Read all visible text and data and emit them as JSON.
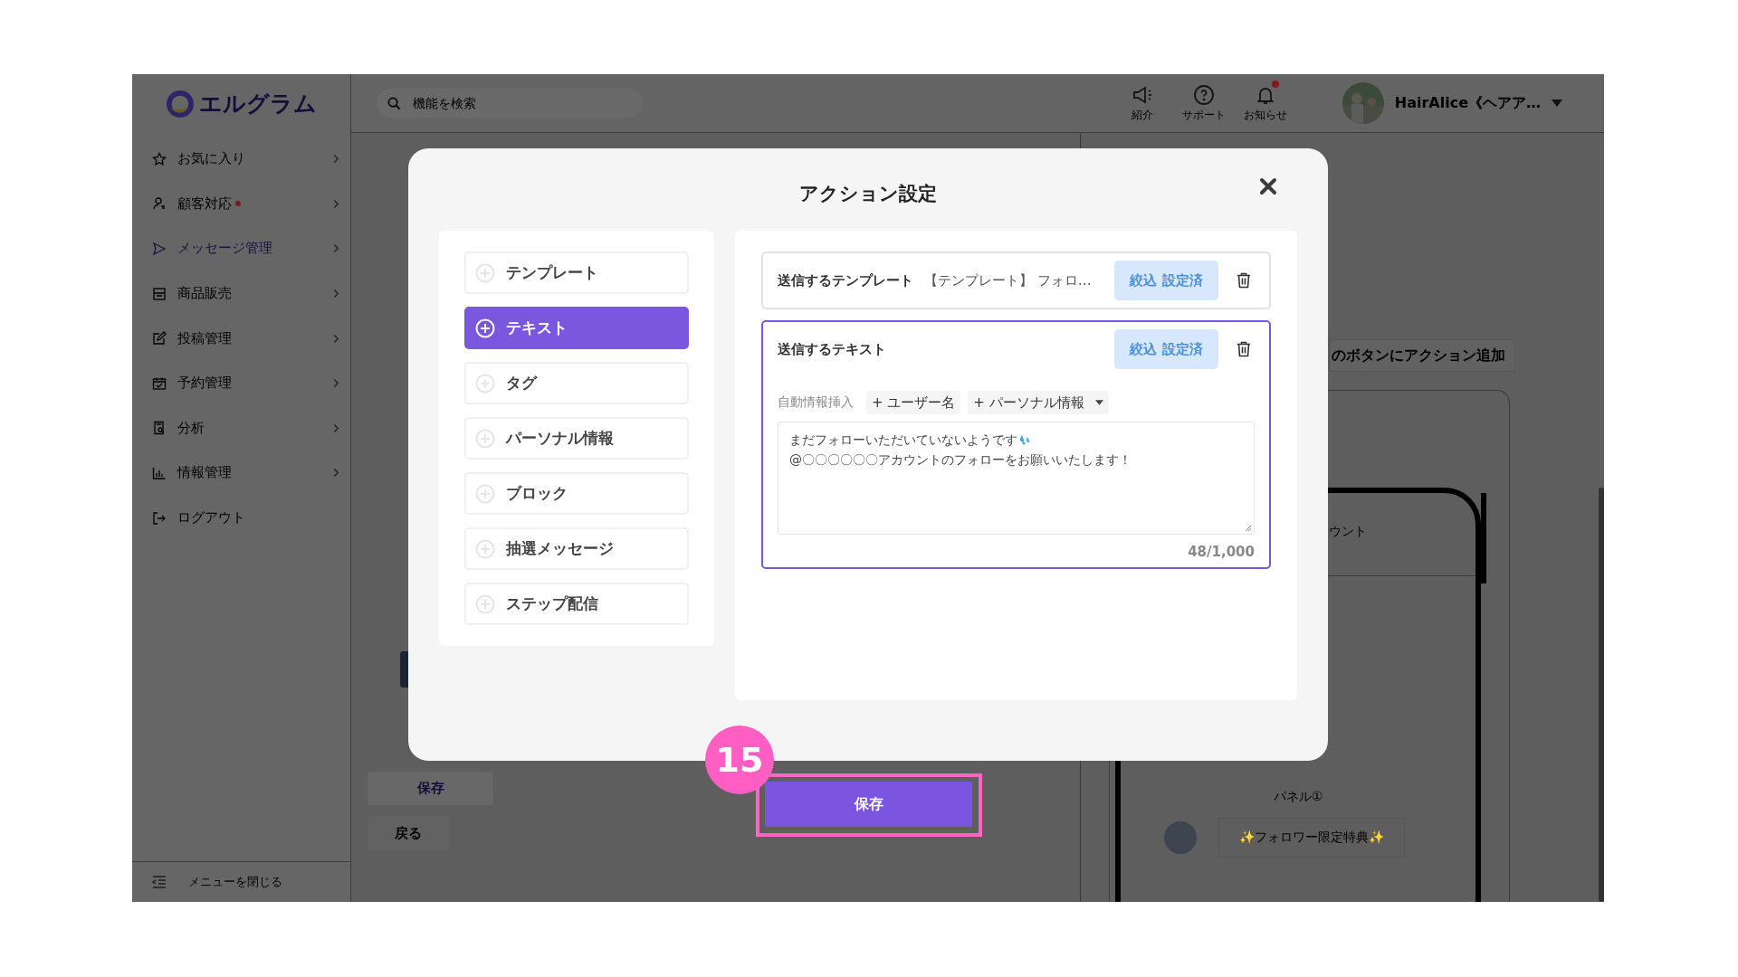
{
  "header": {
    "logo": "エルグラム",
    "search": {
      "placeholder": "機能を検索"
    },
    "icons": [
      {
        "kind": "megaphone",
        "label": "紹介",
        "badge": false
      },
      {
        "kind": "help",
        "label": "サポート",
        "badge": false
      },
      {
        "kind": "bell",
        "label": "お知らせ",
        "badge": true
      }
    ],
    "account": {
      "name": "HairAlice《ヘアア…"
    }
  },
  "sidebar": {
    "items": [
      {
        "label": "お気に入り",
        "selected": false,
        "badge": false,
        "chevron": true
      },
      {
        "label": "顧客対応",
        "selected": false,
        "badge": true,
        "chevron": true
      },
      {
        "label": "メッセージ管理",
        "selected": true,
        "badge": false,
        "chevron": true
      },
      {
        "label": "商品販売",
        "selected": false,
        "badge": false,
        "chevron": true
      },
      {
        "label": "投稿管理",
        "selected": false,
        "badge": false,
        "chevron": true
      },
      {
        "label": "予約管理",
        "selected": false,
        "badge": false,
        "chevron": true
      },
      {
        "label": "分析",
        "selected": false,
        "badge": false,
        "chevron": true
      },
      {
        "label": "情報管理",
        "selected": false,
        "badge": false,
        "chevron": true
      },
      {
        "label": "ログアウト",
        "selected": false,
        "badge": false,
        "chevron": false
      }
    ],
    "collapse_label": "メニューを閉じる"
  },
  "page": {
    "save_button": "保存",
    "back_button": "戻る",
    "add_action_button": "のボタンにアクション追加",
    "preview": {
      "account_text": "ウント",
      "panel_label": "パネル①",
      "panel_button": "✨フォロワー限定特典✨"
    }
  },
  "modal": {
    "title": "アクション設定",
    "action_types": [
      {
        "label": "テンプレート",
        "selected": false
      },
      {
        "label": "テキスト",
        "selected": true
      },
      {
        "label": "タグ",
        "selected": false
      },
      {
        "label": "パーソナル情報",
        "selected": false
      },
      {
        "label": "ブロック",
        "selected": false
      },
      {
        "label": "抽選メッセージ",
        "selected": false
      },
      {
        "label": "ステップ配信",
        "selected": false
      }
    ],
    "actions": [
      {
        "kind": "template",
        "label": "送信するテンプレート",
        "value": "【テンプレート】 フォロ…",
        "filter_button": "絞込 設定済",
        "active": false
      },
      {
        "kind": "text",
        "label": "送信するテキスト",
        "filter_button": "絞込 設定済",
        "active": true,
        "insert_label": "自動情報挿入",
        "insert_chips": [
          {
            "label": "+ ユーザー名",
            "dropdown": false
          },
          {
            "label": "+ パーソナル情報",
            "dropdown": true
          }
        ],
        "lines": [
          "まだフォローいただいていないようです",
          "@〇〇〇〇〇〇アカウントのフォローをお願いいたします！"
        ],
        "counter": "48/1,000"
      }
    ],
    "save_button": "保存"
  },
  "step_badge": "15"
}
